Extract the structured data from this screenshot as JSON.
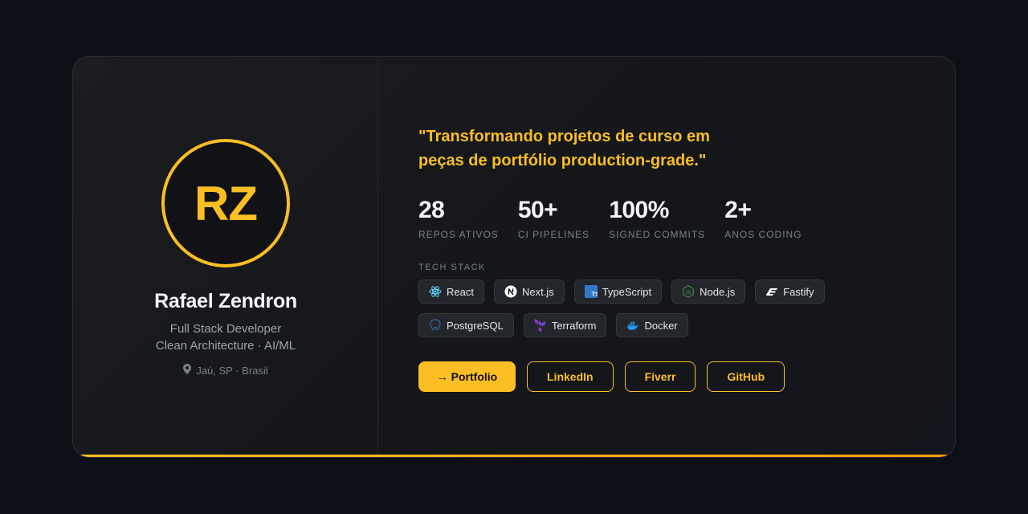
{
  "profile": {
    "initials": "RZ",
    "name": "Rafael Zendron",
    "role_line1": "Full Stack Developer",
    "role_line2": "Clean Architecture · AI/ML",
    "location": "Jaú, SP · Brasil"
  },
  "quote": {
    "line1": "\"Transformando projetos de curso em",
    "line2": "peças de portfólio production-grade.\""
  },
  "stats": [
    {
      "value": "28",
      "label": "REPOS ATIVOS"
    },
    {
      "value": "50+",
      "label": "CI PIPELINES"
    },
    {
      "value": "100%",
      "label": "SIGNED COMMITS"
    },
    {
      "value": "2+",
      "label": "ANOS CODING"
    }
  ],
  "tech_stack": {
    "label": "TECH STACK",
    "items": [
      {
        "label": "React",
        "icon": "react-icon"
      },
      {
        "label": "Next.js",
        "icon": "nextjs-icon"
      },
      {
        "label": "TypeScript",
        "icon": "typescript-icon"
      },
      {
        "label": "Node.js",
        "icon": "nodejs-icon"
      },
      {
        "label": "Fastify",
        "icon": "fastify-icon"
      },
      {
        "label": "PostgreSQL",
        "icon": "postgresql-icon"
      },
      {
        "label": "Terraform",
        "icon": "terraform-icon"
      },
      {
        "label": "Docker",
        "icon": "docker-icon"
      }
    ]
  },
  "buttons": {
    "portfolio": "→ Portfolio",
    "linkedin": "LinkedIn",
    "fiverr": "Fiverr",
    "github": "GitHub"
  },
  "colors": {
    "accent": "#fbbf24",
    "background": "#0c0f16",
    "card": "#18191d"
  }
}
